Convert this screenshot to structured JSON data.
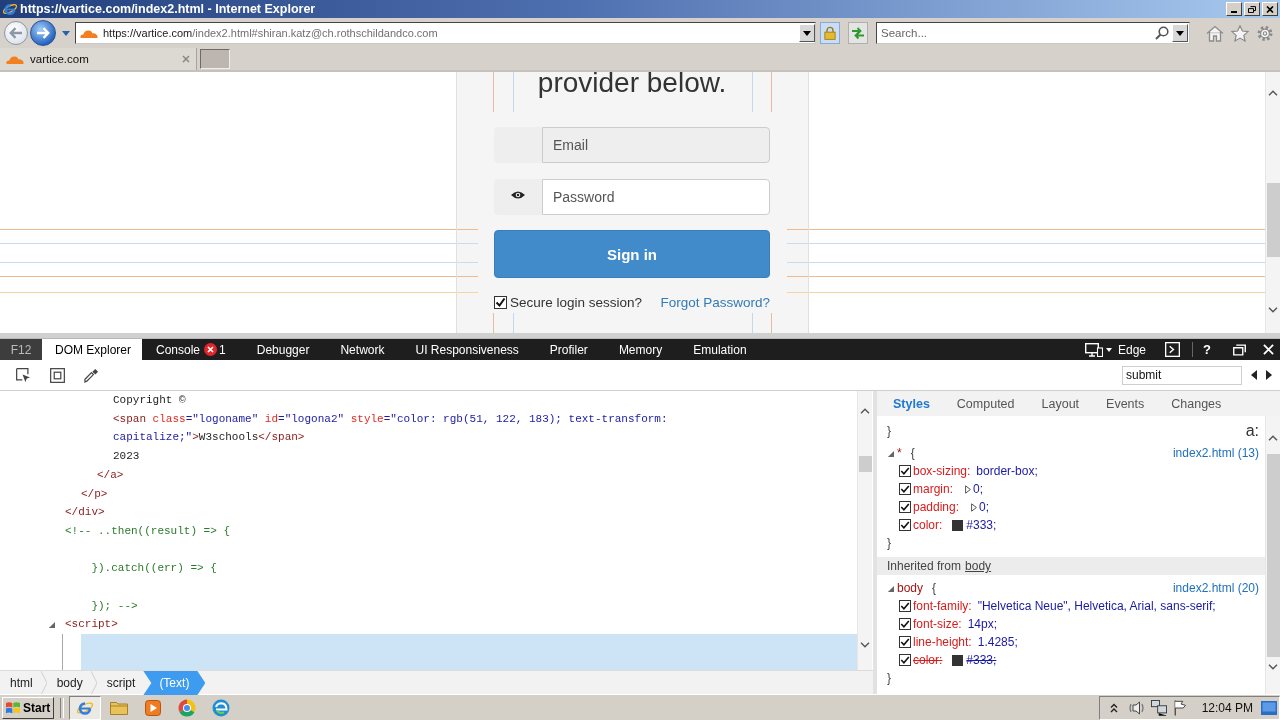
{
  "window": {
    "title": "https://vartice.com/index2.html - Internet Explorer"
  },
  "address_bar": {
    "host": "https://vartice.com",
    "path": "/index2.html#shiran.katz@ch.rothschildandco.com"
  },
  "search": {
    "placeholder": "Search..."
  },
  "tabs": [
    {
      "label": "vartice.com",
      "selected": true
    }
  ],
  "page": {
    "heading": "provider below.",
    "fields": [
      {
        "kind": "email",
        "placeholder": "Email",
        "disabled": true
      },
      {
        "kind": "password",
        "placeholder": "Password",
        "disabled": false
      }
    ],
    "submit": "Sign in",
    "remember": {
      "label": "Secure login session?",
      "checked": true
    },
    "forgot_link": "Forgot Password?"
  },
  "devtools": {
    "f12": "F12",
    "tabs": [
      {
        "label": "DOM Explorer",
        "selected": true
      },
      {
        "label": "Console",
        "selected": false,
        "errors": "1"
      },
      {
        "label": "Debugger",
        "selected": false
      },
      {
        "label": "Network",
        "selected": false
      },
      {
        "label": "UI Responsiveness",
        "selected": false
      },
      {
        "label": "Profiler",
        "selected": false
      },
      {
        "label": "Memory",
        "selected": false
      },
      {
        "label": "Emulation",
        "selected": false
      }
    ],
    "mode": "Edge",
    "help": "?",
    "find": {
      "value": "submit"
    },
    "dom_tree": [
      {
        "kind": "element",
        "selected": false,
        "close": "</div>",
        "children": [
          {
            "kind": "element",
            "selected": false,
            "close": "</p>",
            "children": [
              {
                "kind": "element",
                "selected": false,
                "close": "</a>",
                "children": [
                  {
                    "kind": "text",
                    "selected": false,
                    "text": "Copyright ©"
                  },
                  {
                    "kind": "element",
                    "selected": false,
                    "tokens": [
                      {
                        "kind": "tag",
                        "text": "<span"
                      },
                      {
                        "kind": "attr",
                        "text": " class"
                      },
                      {
                        "kind": "punct",
                        "text": "="
                      },
                      {
                        "kind": "value",
                        "text": "\"logoname\""
                      },
                      {
                        "kind": "attr",
                        "text": " id"
                      },
                      {
                        "kind": "punct",
                        "text": "="
                      },
                      {
                        "kind": "value",
                        "text": "\"logona2\""
                      },
                      {
                        "kind": "attr",
                        "text": " style"
                      },
                      {
                        "kind": "punct",
                        "text": "="
                      },
                      {
                        "kind": "value",
                        "text": "\"color: rgb(51, 122, 183); text-transform: capitalize;\""
                      },
                      {
                        "kind": "tag",
                        "text": ">"
                      },
                      {
                        "kind": "text",
                        "text": "W3schools"
                      },
                      {
                        "kind": "tag",
                        "text": "</span>"
                      }
                    ]
                  },
                  {
                    "kind": "text",
                    "selected": false,
                    "text": "2023"
                  }
                ]
              }
            ]
          }
        ]
      },
      {
        "kind": "comment",
        "selected": false,
        "text": "<!-- ..then((result) => {\n\n    }).catch((err) => {\n\n    }); -->"
      },
      {
        "kind": "element",
        "selected": false,
        "expanded": true,
        "tokens": [
          {
            "kind": "tag",
            "text": "<script>"
          }
        ],
        "children": [
          {
            "kind": "text",
            "selected": true
          }
        ]
      }
    ],
    "breadcrumb": [
      {
        "label": "html",
        "selected": false
      },
      {
        "label": "body",
        "selected": false
      },
      {
        "label": "script",
        "selected": false
      },
      {
        "label": "(Text)",
        "selected": true
      }
    ],
    "styles": {
      "tabs": [
        {
          "label": "Styles",
          "selected": true
        },
        {
          "label": "Computed",
          "selected": false
        },
        {
          "label": "Layout",
          "selected": false
        },
        {
          "label": "Events",
          "selected": false
        },
        {
          "label": "Changes",
          "selected": false
        }
      ],
      "pseudo_toggle": "a:",
      "rules": [
        {
          "kind": "brace",
          "text": "}"
        },
        {
          "kind": "rule",
          "selector": "*",
          "open": "{",
          "source": "index2.html (13)",
          "expanded": true,
          "close": "}",
          "properties": [
            {
              "name": "box-sizing:",
              "value": "border-box;",
              "checked": true,
              "overridden": false
            },
            {
              "name": "margin:",
              "value": "0;",
              "expanded": false,
              "checked": true,
              "overridden": false
            },
            {
              "name": "padding:",
              "value": "0;",
              "expanded": false,
              "checked": true,
              "overridden": false
            },
            {
              "name": "color:",
              "value": "#333;",
              "color": "#333333",
              "checked": true,
              "overridden": false
            }
          ]
        },
        {
          "kind": "inherited",
          "label": "Inherited from",
          "from": "body"
        },
        {
          "kind": "rule",
          "selector": "body",
          "open": "{",
          "source": "index2.html (20)",
          "expanded": true,
          "close": "}",
          "properties": [
            {
              "name": "font-family:",
              "value": "\"Helvetica Neue\", Helvetica, Arial, sans-serif;",
              "checked": true,
              "overridden": false
            },
            {
              "name": "font-size:",
              "value": "14px;",
              "checked": true,
              "overridden": false
            },
            {
              "name": "line-height:",
              "value": "1.4285;",
              "checked": true,
              "overridden": false
            },
            {
              "name": "color:",
              "value": "#333;",
              "color": "#333333",
              "checked": true,
              "overridden": true
            }
          ]
        }
      ]
    }
  },
  "taskbar": {
    "start": "Start",
    "pinned": [
      {
        "selected": true
      },
      {
        "selected": false
      },
      {
        "selected": false
      },
      {
        "selected": false
      },
      {
        "selected": false
      }
    ],
    "clock": "12:04 PM"
  }
}
